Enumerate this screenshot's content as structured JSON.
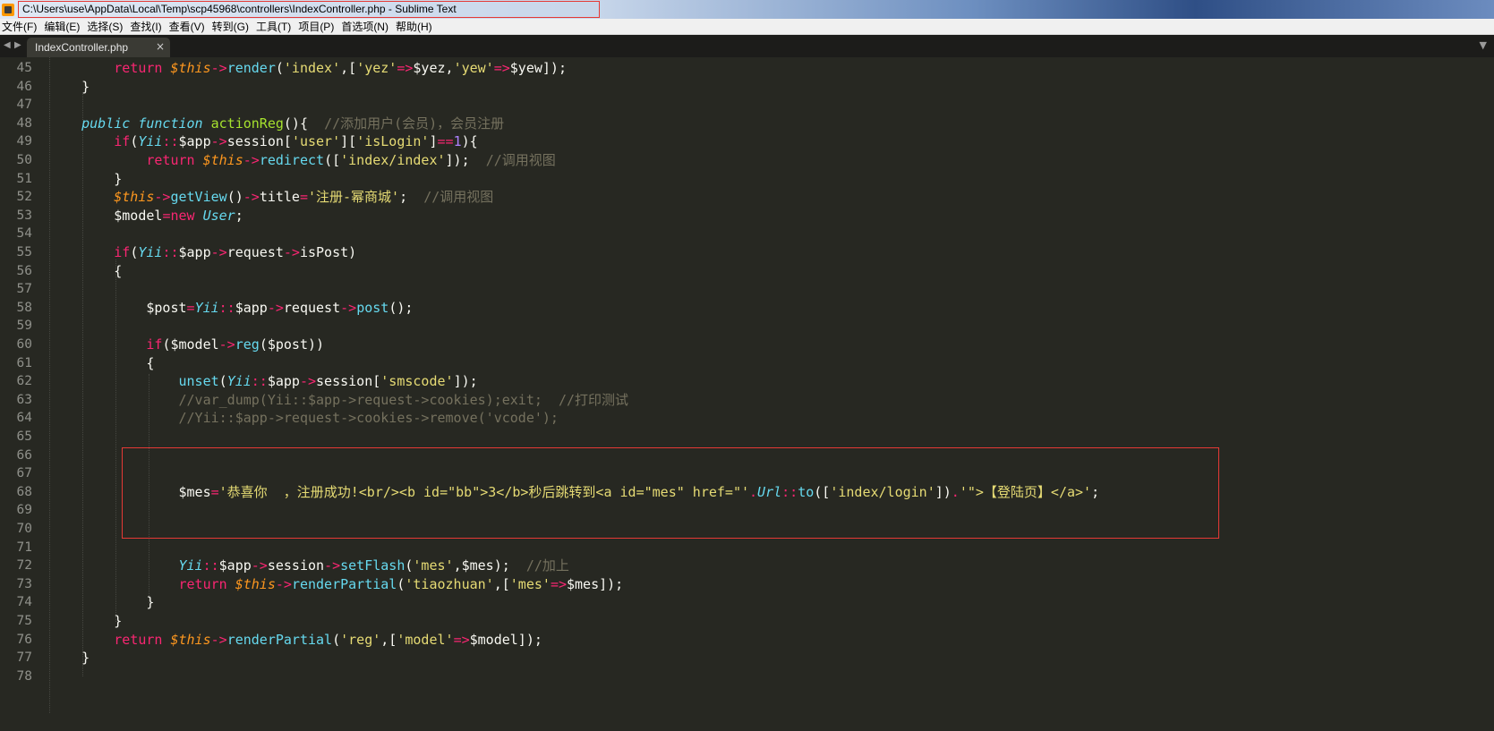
{
  "window": {
    "title": "C:\\Users\\use\\AppData\\Local\\Temp\\scp45968\\controllers\\IndexController.php - Sublime Text"
  },
  "menu": [
    "文件(F)",
    "编辑(E)",
    "选择(S)",
    "查找(I)",
    "查看(V)",
    "转到(G)",
    "工具(T)",
    "项目(P)",
    "首选项(N)",
    "帮助(H)"
  ],
  "tabs": [
    {
      "label": "IndexController.php",
      "close": "×"
    }
  ],
  "nav": {
    "prev": "◀",
    "next": "▶",
    "dropdown": "▼"
  },
  "colors": {
    "editor_bg": "#272822",
    "keyword": "#f92672",
    "storage": "#66d9ef",
    "string": "#e6db74",
    "function": "#a6e22e",
    "variable": "#fd971f",
    "number": "#ae81ff",
    "comment": "#75715e",
    "highlight_border": "#e53935"
  },
  "editor": {
    "lines": [
      {
        "n": "45",
        "tokens": [
          [
            "pl",
            "        "
          ],
          [
            "kw",
            "return "
          ],
          [
            "var",
            "$this"
          ],
          [
            "kw",
            "->"
          ],
          [
            "fn",
            "render"
          ],
          [
            "pl",
            "("
          ],
          [
            "str",
            "'index'"
          ],
          [
            "pl",
            ",["
          ],
          [
            "str",
            "'yez'"
          ],
          [
            "kw",
            "=>"
          ],
          [
            "pl",
            "$yez,"
          ],
          [
            "str",
            "'yew'"
          ],
          [
            "kw",
            "=>"
          ],
          [
            "pl",
            "$yew]);"
          ]
        ]
      },
      {
        "n": "46",
        "tokens": [
          [
            "pl",
            "    }"
          ]
        ]
      },
      {
        "n": "47",
        "tokens": []
      },
      {
        "n": "48",
        "tokens": [
          [
            "pl",
            "    "
          ],
          [
            "sto",
            "public function "
          ],
          [
            "fnd",
            "actionReg"
          ],
          [
            "pl",
            "(){  "
          ],
          [
            "cm",
            "//添加用户(会员)，会员注册"
          ]
        ]
      },
      {
        "n": "49",
        "tokens": [
          [
            "pl",
            "        "
          ],
          [
            "kw",
            "if"
          ],
          [
            "pl",
            "("
          ],
          [
            "sto",
            "Yii"
          ],
          [
            "kw",
            "::"
          ],
          [
            "pl",
            "$app"
          ],
          [
            "kw",
            "->"
          ],
          [
            "pl",
            "session["
          ],
          [
            "str",
            "'user'"
          ],
          [
            "pl",
            "]["
          ],
          [
            "str",
            "'isLogin'"
          ],
          [
            "pl",
            "]"
          ],
          [
            "kw",
            "=="
          ],
          [
            "num",
            "1"
          ],
          [
            "pl",
            "){"
          ]
        ]
      },
      {
        "n": "50",
        "tokens": [
          [
            "pl",
            "            "
          ],
          [
            "kw",
            "return "
          ],
          [
            "var",
            "$this"
          ],
          [
            "kw",
            "->"
          ],
          [
            "fn",
            "redirect"
          ],
          [
            "pl",
            "(["
          ],
          [
            "str",
            "'index/index'"
          ],
          [
            "pl",
            "]);  "
          ],
          [
            "cm",
            "//调用视图"
          ]
        ]
      },
      {
        "n": "51",
        "tokens": [
          [
            "pl",
            "        }"
          ]
        ]
      },
      {
        "n": "52",
        "tokens": [
          [
            "pl",
            "        "
          ],
          [
            "var",
            "$this"
          ],
          [
            "kw",
            "->"
          ],
          [
            "fn",
            "getView"
          ],
          [
            "pl",
            "()"
          ],
          [
            "kw",
            "->"
          ],
          [
            "pl",
            "title"
          ],
          [
            "kw",
            "="
          ],
          [
            "str",
            "'注册-幂商城'"
          ],
          [
            "pl",
            ";  "
          ],
          [
            "cm",
            "//调用视图"
          ]
        ]
      },
      {
        "n": "53",
        "tokens": [
          [
            "pl",
            "        $model"
          ],
          [
            "kw",
            "=new "
          ],
          [
            "sto",
            "User"
          ],
          [
            "pl",
            ";"
          ]
        ]
      },
      {
        "n": "54",
        "tokens": []
      },
      {
        "n": "55",
        "tokens": [
          [
            "pl",
            "        "
          ],
          [
            "kw",
            "if"
          ],
          [
            "pl",
            "("
          ],
          [
            "sto",
            "Yii"
          ],
          [
            "kw",
            "::"
          ],
          [
            "pl",
            "$app"
          ],
          [
            "kw",
            "->"
          ],
          [
            "pl",
            "request"
          ],
          [
            "kw",
            "->"
          ],
          [
            "pl",
            "isPost)"
          ]
        ]
      },
      {
        "n": "56",
        "tokens": [
          [
            "pl",
            "        {"
          ]
        ]
      },
      {
        "n": "57",
        "tokens": []
      },
      {
        "n": "58",
        "tokens": [
          [
            "pl",
            "            $post"
          ],
          [
            "kw",
            "="
          ],
          [
            "sto",
            "Yii"
          ],
          [
            "kw",
            "::"
          ],
          [
            "pl",
            "$app"
          ],
          [
            "kw",
            "->"
          ],
          [
            "pl",
            "request"
          ],
          [
            "kw",
            "->"
          ],
          [
            "fn",
            "post"
          ],
          [
            "pl",
            "();"
          ]
        ]
      },
      {
        "n": "59",
        "tokens": []
      },
      {
        "n": "60",
        "tokens": [
          [
            "pl",
            "            "
          ],
          [
            "kw",
            "if"
          ],
          [
            "pl",
            "($model"
          ],
          [
            "kw",
            "->"
          ],
          [
            "fn",
            "reg"
          ],
          [
            "pl",
            "($post))"
          ]
        ]
      },
      {
        "n": "61",
        "tokens": [
          [
            "pl",
            "            {"
          ]
        ]
      },
      {
        "n": "62",
        "tokens": [
          [
            "pl",
            "                "
          ],
          [
            "fn",
            "unset"
          ],
          [
            "pl",
            "("
          ],
          [
            "sto",
            "Yii"
          ],
          [
            "kw",
            "::"
          ],
          [
            "pl",
            "$app"
          ],
          [
            "kw",
            "->"
          ],
          [
            "pl",
            "session["
          ],
          [
            "str",
            "'smscode'"
          ],
          [
            "pl",
            "]);"
          ]
        ]
      },
      {
        "n": "63",
        "tokens": [
          [
            "pl",
            "                "
          ],
          [
            "cm",
            "//var_dump(Yii::$app->request->cookies);exit;  //打印测试"
          ]
        ]
      },
      {
        "n": "64",
        "tokens": [
          [
            "pl",
            "                "
          ],
          [
            "cm",
            "//Yii::$app->request->cookies->remove('vcode');"
          ]
        ]
      },
      {
        "n": "65",
        "tokens": []
      },
      {
        "n": "66",
        "tokens": []
      },
      {
        "n": "67",
        "tokens": []
      },
      {
        "n": "68",
        "tokens": [
          [
            "pl",
            "                $mes"
          ],
          [
            "kw",
            "="
          ],
          [
            "str",
            "'恭喜你  ，注册成功!<br/><b id=\"bb\">3</b>秒后跳转到<a id=\"mes\" href=\"'"
          ],
          [
            "kw",
            "."
          ],
          [
            "sto",
            "Url"
          ],
          [
            "kw",
            "::"
          ],
          [
            "fn",
            "to"
          ],
          [
            "pl",
            "(["
          ],
          [
            "str",
            "'index/login'"
          ],
          [
            "pl",
            "])"
          ],
          [
            "kw",
            "."
          ],
          [
            "str",
            "'\">【登陆页】</a>'"
          ],
          [
            "pl",
            ";"
          ]
        ]
      },
      {
        "n": "69",
        "tokens": []
      },
      {
        "n": "70",
        "tokens": []
      },
      {
        "n": "71",
        "tokens": []
      },
      {
        "n": "72",
        "tokens": [
          [
            "pl",
            "                "
          ],
          [
            "sto",
            "Yii"
          ],
          [
            "kw",
            "::"
          ],
          [
            "pl",
            "$app"
          ],
          [
            "kw",
            "->"
          ],
          [
            "pl",
            "session"
          ],
          [
            "kw",
            "->"
          ],
          [
            "fn",
            "setFlash"
          ],
          [
            "pl",
            "("
          ],
          [
            "str",
            "'mes'"
          ],
          [
            "pl",
            ",$mes);  "
          ],
          [
            "cm",
            "//加上"
          ]
        ]
      },
      {
        "n": "73",
        "tokens": [
          [
            "pl",
            "                "
          ],
          [
            "kw",
            "return "
          ],
          [
            "var",
            "$this"
          ],
          [
            "kw",
            "->"
          ],
          [
            "fn",
            "renderPartial"
          ],
          [
            "pl",
            "("
          ],
          [
            "str",
            "'tiaozhuan'"
          ],
          [
            "pl",
            ",["
          ],
          [
            "str",
            "'mes'"
          ],
          [
            "kw",
            "=>"
          ],
          [
            "pl",
            "$mes]);"
          ]
        ]
      },
      {
        "n": "74",
        "tokens": [
          [
            "pl",
            "            }"
          ]
        ]
      },
      {
        "n": "75",
        "tokens": [
          [
            "pl",
            "        }"
          ]
        ]
      },
      {
        "n": "76",
        "tokens": [
          [
            "pl",
            "        "
          ],
          [
            "kw",
            "return "
          ],
          [
            "var",
            "$this"
          ],
          [
            "kw",
            "->"
          ],
          [
            "fn",
            "renderPartial"
          ],
          [
            "pl",
            "("
          ],
          [
            "str",
            "'reg'"
          ],
          [
            "pl",
            ",["
          ],
          [
            "str",
            "'model'"
          ],
          [
            "kw",
            "=>"
          ],
          [
            "pl",
            "$model]);"
          ]
        ]
      },
      {
        "n": "77",
        "tokens": [
          [
            "pl",
            "    }"
          ]
        ]
      },
      {
        "n": "78",
        "tokens": []
      }
    ]
  }
}
